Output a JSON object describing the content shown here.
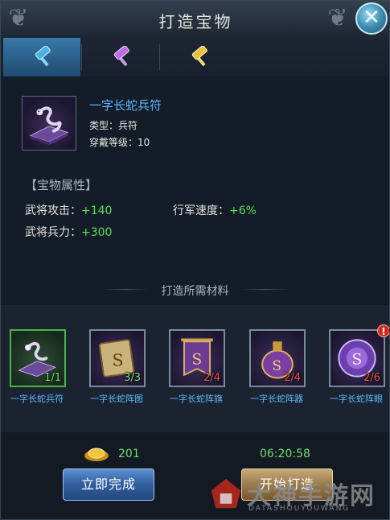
{
  "window": {
    "title": "打造宝物",
    "close_icon": "close-x-icon"
  },
  "tabs": [
    {
      "name": "blue-hammer",
      "color": "#4ab3e6",
      "active": true
    },
    {
      "name": "purple-hammer",
      "color": "#b86de0",
      "active": false
    },
    {
      "name": "gold-hammer",
      "color": "#e8c23a",
      "active": false
    }
  ],
  "item": {
    "name": "一字长蛇兵符",
    "type_line": "类型：兵符",
    "level_line": "穿戴等级：10",
    "icon": "purple-snake-talisman-icon"
  },
  "attributes": {
    "section_title": "【宝物属性】",
    "rows": [
      {
        "label": "武将攻击：",
        "value": "+140"
      },
      {
        "label": "行军速度：",
        "value": "+6%"
      },
      {
        "label": "武将兵力：",
        "value": "+300"
      }
    ]
  },
  "materials": {
    "title": "打造所需材料",
    "items": [
      {
        "name": "一字长蛇兵符",
        "count": "1/1",
        "enough": true,
        "icon": "snake-talisman-icon"
      },
      {
        "name": "一字长蛇阵图",
        "count": "3/3",
        "enough": true,
        "icon": "formation-scroll-icon"
      },
      {
        "name": "一字长蛇阵旗",
        "count": "2/4",
        "enough": false,
        "icon": "formation-banner-icon"
      },
      {
        "name": "一字长蛇阵器",
        "count": "2/4",
        "enough": false,
        "icon": "formation-vessel-icon"
      },
      {
        "name": "一字长蛇阵眼",
        "count": "2/6",
        "enough": false,
        "icon": "formation-orb-icon",
        "alert": "!"
      }
    ]
  },
  "footer": {
    "gold_amount": "201",
    "timer": "06:20:58",
    "instant_button": "立即完成",
    "start_button": "开始打造"
  },
  "watermark": {
    "text": "大神手游网",
    "subtext": "DATASHOUYOUWANG"
  }
}
